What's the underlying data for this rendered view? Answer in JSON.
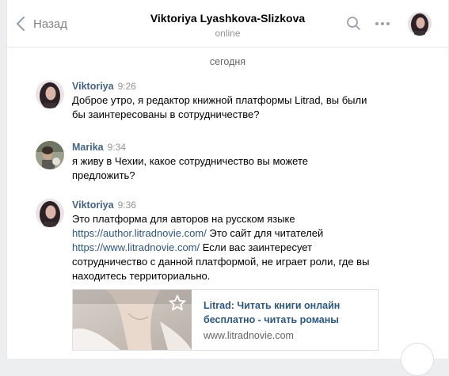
{
  "header": {
    "back_label": "Назад",
    "peer_name": "Viktoriya Lyashkova-Slizkova",
    "peer_status": "online"
  },
  "day_separator": "сегодня",
  "messages": [
    {
      "author": "Viktoriya",
      "time": "9:26",
      "lines": [
        "Доброе утро, я редактор книжной платформы Litrad, вы были",
        "бы заинтересованы в сотрудничестве?"
      ]
    },
    {
      "author": "Marika",
      "time": "9:34",
      "lines": [
        "я живу в Чехии, какое сотрудничество вы можете",
        "предложить?"
      ]
    },
    {
      "author": "Viktoriya",
      "time": "9:36",
      "line1": "Это платформа для авторов на русском языке",
      "link1": "https://author.litradnovie.com/",
      "after_link1": " Это сайт для читателей",
      "link2": "https://www.litradnovie.com/",
      "after_link2": " Если вас заинтересует",
      "line4": "сотрудничество с данной платформой, не играет роли, где вы",
      "line5": "находитесь территориально."
    }
  ],
  "link_card": {
    "title_line1": "Litrad: Читать книги онлайн",
    "title_line2": "бесплатно - читать романы",
    "domain": "www.litradnovie.com"
  },
  "colors": {
    "accent_link": "#2a5885",
    "author_name": "#42648b",
    "muted": "#939393",
    "divider": "#e7e8ec"
  },
  "icons": [
    "chevron-left-icon",
    "search-icon",
    "more-icon",
    "star-icon",
    "chevron-down-icon"
  ]
}
